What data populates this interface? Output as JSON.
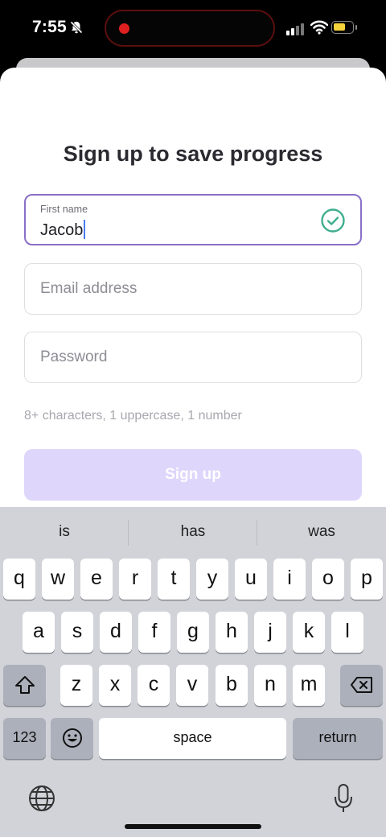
{
  "status_bar": {
    "time": "7:55",
    "icons": [
      "bell-slash-icon",
      "recording-dot-icon",
      "signal-icon",
      "wifi-icon",
      "battery-icon"
    ]
  },
  "form": {
    "title": "Sign up to save progress",
    "first_name": {
      "label": "First name",
      "value": "Jacob",
      "valid": true
    },
    "email": {
      "placeholder": "Email address"
    },
    "password": {
      "placeholder": "Password"
    },
    "password_hint": "8+ characters, 1 uppercase, 1 number",
    "submit_label": "Sign up"
  },
  "keyboard": {
    "suggestions": [
      "is",
      "has",
      "was"
    ],
    "row1": [
      "q",
      "w",
      "e",
      "r",
      "t",
      "y",
      "u",
      "i",
      "o",
      "p"
    ],
    "row2": [
      "a",
      "s",
      "d",
      "f",
      "g",
      "h",
      "j",
      "k",
      "l"
    ],
    "row3": [
      "z",
      "x",
      "c",
      "v",
      "b",
      "n",
      "m"
    ],
    "numbers_label": "123",
    "space_label": "space",
    "return_label": "return"
  },
  "colors": {
    "accent_border": "#8a6fc7",
    "check_green": "#3fae8e",
    "signup_disabled": "#ded6fb"
  }
}
